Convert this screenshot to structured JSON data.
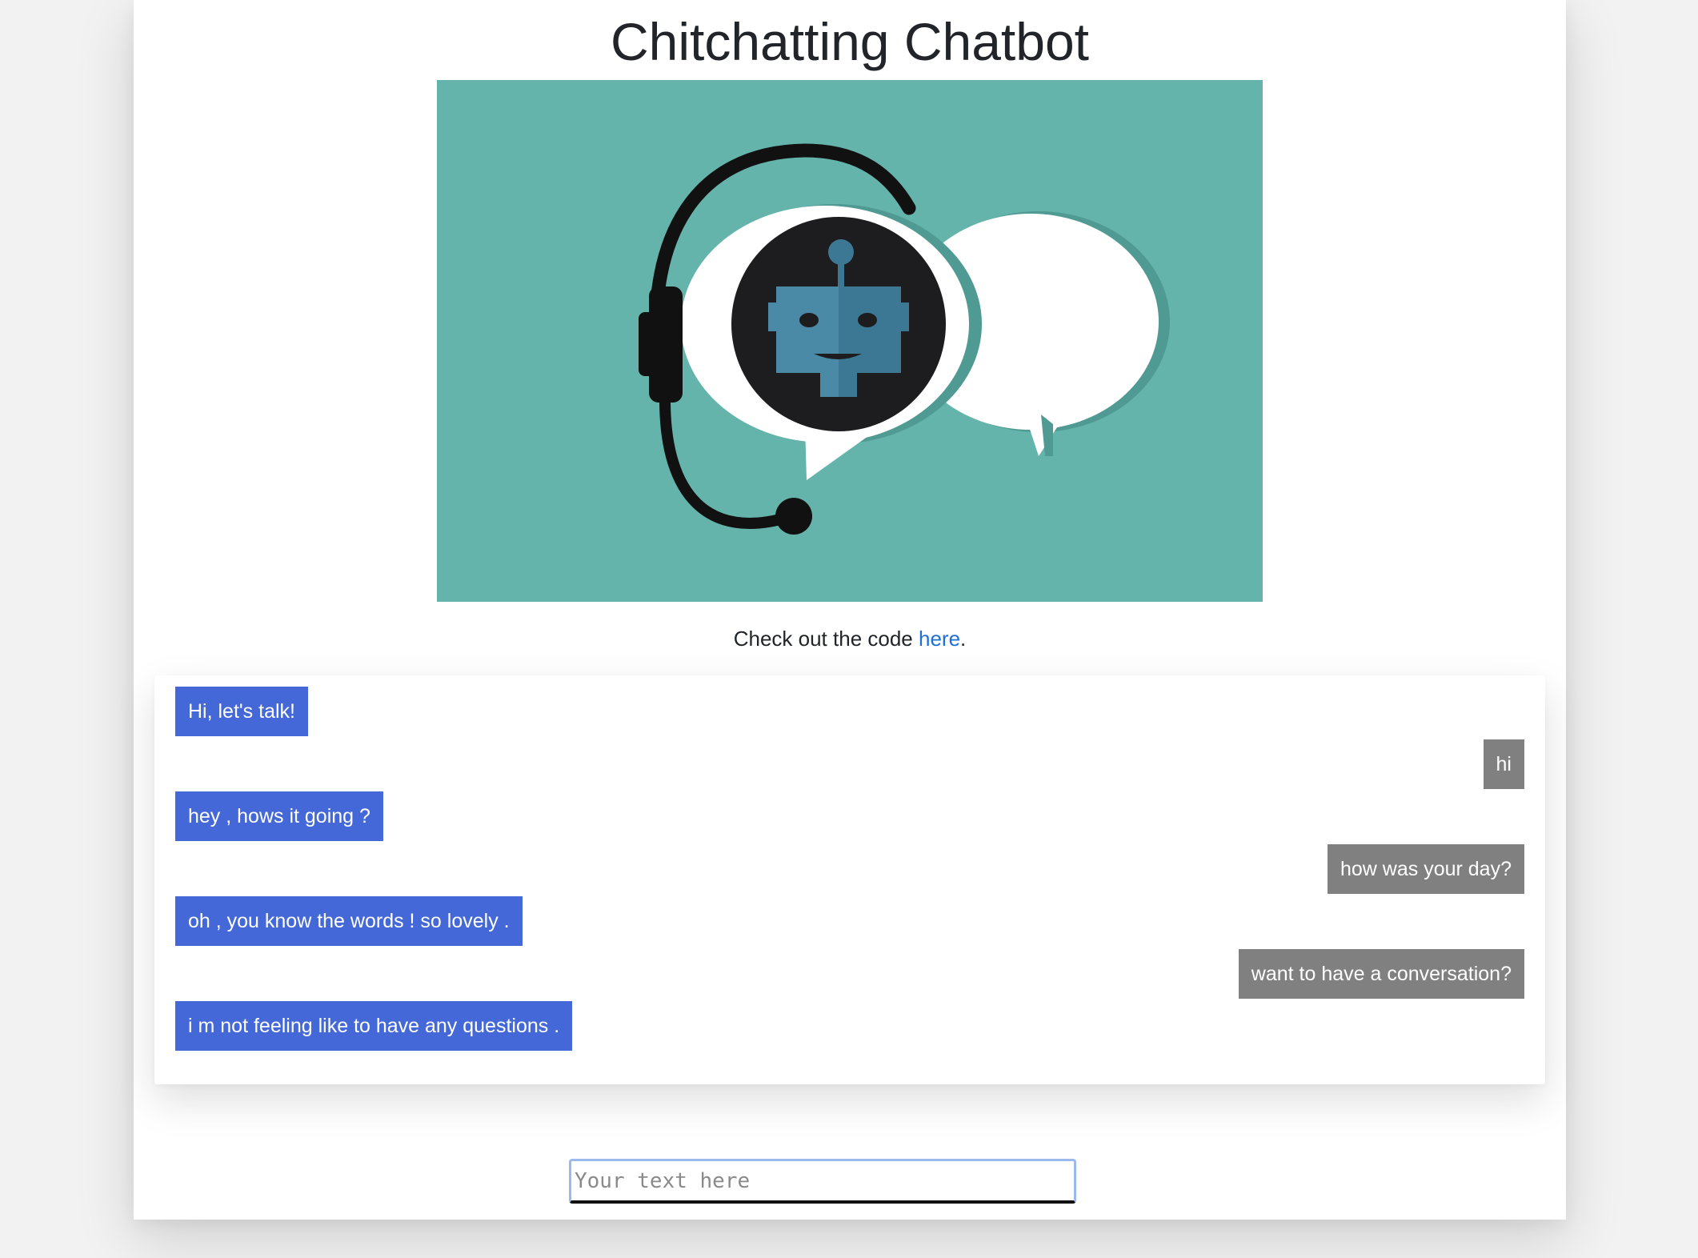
{
  "page": {
    "title": "Chitchatting Chatbot",
    "hero_image_icon": "chatbot-headset-icon",
    "code_text": "Check out the code ",
    "code_link": "here",
    "code_period": "."
  },
  "chat": {
    "messages": [
      {
        "role": "bot",
        "text": "Hi, let's talk!"
      },
      {
        "role": "user",
        "text": "hi"
      },
      {
        "role": "bot",
        "text": "hey , hows it going ?"
      },
      {
        "role": "user",
        "text": "how was your day?"
      },
      {
        "role": "bot",
        "text": "oh , you know the words ! so lovely ."
      },
      {
        "role": "user",
        "text": "want to have a conversation?"
      },
      {
        "role": "bot",
        "text": "i m not feeling like to have any questions ."
      }
    ]
  },
  "input": {
    "placeholder": "Your text here",
    "value": ""
  },
  "colors": {
    "bot_bubble": "#4468d8",
    "user_bubble": "#808080",
    "hero_background": "#65b4ab",
    "link": "#1f6fd6"
  }
}
